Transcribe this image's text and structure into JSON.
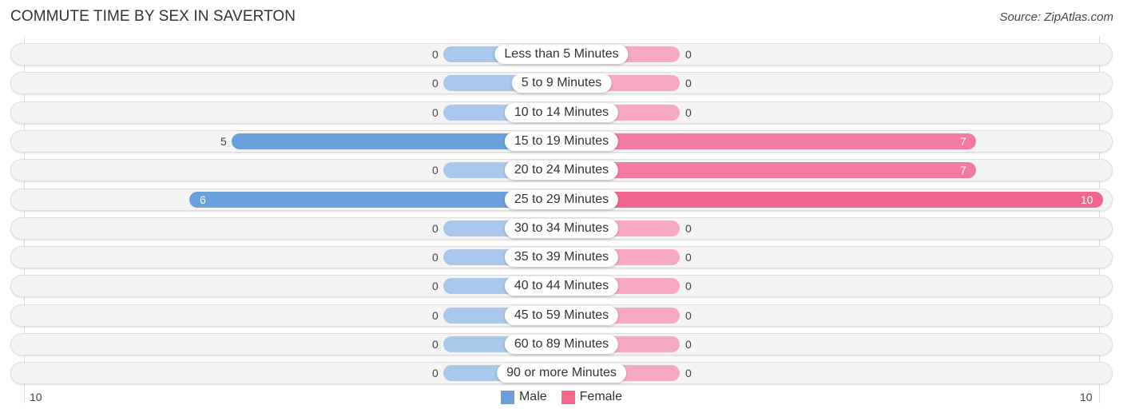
{
  "title": "COMMUTE TIME BY SEX IN SAVERTON",
  "source": "Source: ZipAtlas.com",
  "colors": {
    "male": "#6aa1dc",
    "male_light": "#a9c8ec",
    "female": "#f27aa0",
    "female_strong": "#f06690",
    "female_light": "#f7a9c3"
  },
  "legend": [
    {
      "label": "Male",
      "color": "#6aa1dc"
    },
    {
      "label": "Female",
      "color": "#f4688f"
    }
  ],
  "axis": {
    "left_tick": "10",
    "right_tick": "10"
  },
  "chart_data": {
    "type": "bar",
    "orientation": "horizontal-diverging",
    "title": "COMMUTE TIME BY SEX IN SAVERTON",
    "categories": [
      "Less than 5 Minutes",
      "5 to 9 Minutes",
      "10 to 14 Minutes",
      "15 to 19 Minutes",
      "20 to 24 Minutes",
      "25 to 29 Minutes",
      "30 to 34 Minutes",
      "35 to 39 Minutes",
      "40 to 44 Minutes",
      "45 to 59 Minutes",
      "60 to 89 Minutes",
      "90 or more Minutes"
    ],
    "series": [
      {
        "name": "Male",
        "values": [
          0,
          0,
          0,
          5,
          0,
          6,
          0,
          0,
          0,
          0,
          0,
          0
        ]
      },
      {
        "name": "Female",
        "values": [
          0,
          0,
          0,
          7,
          7,
          10,
          0,
          0,
          0,
          0,
          0,
          0
        ]
      }
    ],
    "xlim": [
      10,
      10
    ],
    "tick_labels": [
      "10",
      "10"
    ],
    "legend_position": "bottom-center",
    "grid": false
  }
}
